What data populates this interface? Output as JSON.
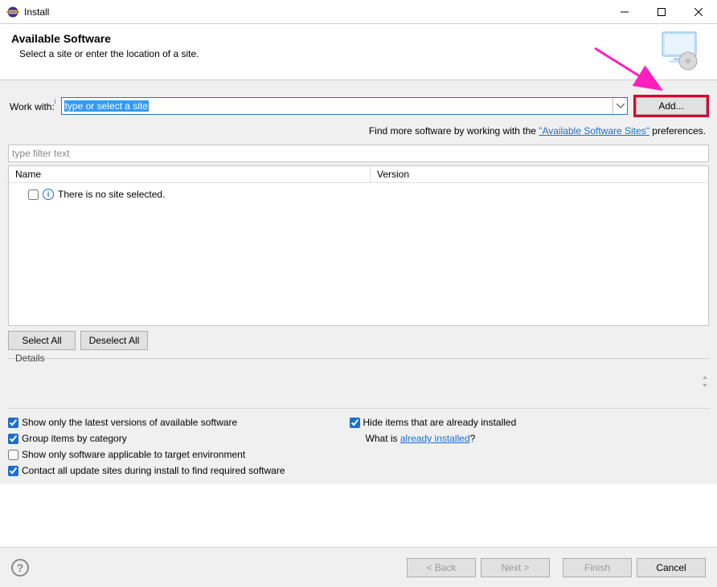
{
  "window": {
    "title": "Install"
  },
  "banner": {
    "heading": "Available Software",
    "subtext": "Select a site or enter the location of a site."
  },
  "workwith": {
    "label": "Work with:",
    "combo_text": "type or select a site",
    "add_button": "Add..."
  },
  "findmore": {
    "prefix": "Find more software by working with the ",
    "link": "\"Available Software Sites\"",
    "suffix": " preferences."
  },
  "filter": {
    "placeholder": "type filter text"
  },
  "tree": {
    "col_name": "Name",
    "col_version": "Version",
    "empty_row": "There is no site selected."
  },
  "buttons": {
    "select_all": "Select All",
    "deselect_all": "Deselect All"
  },
  "details": {
    "legend": "Details"
  },
  "options": {
    "show_latest": "Show only the latest versions of available software",
    "group_by_cat": "Group items by category",
    "target_env": "Show only software applicable to target environment",
    "contact_all": "Contact all update sites during install to find required software",
    "hide_installed": "Hide items that are already installed",
    "whatis_prefix": "What is ",
    "whatis_link": "already installed",
    "whatis_suffix": "?"
  },
  "footer": {
    "back": "< Back",
    "next": "Next >",
    "finish": "Finish",
    "cancel": "Cancel"
  },
  "checked": {
    "show_latest": true,
    "group_by_cat": true,
    "target_env": false,
    "contact_all": true,
    "hide_installed": true
  }
}
